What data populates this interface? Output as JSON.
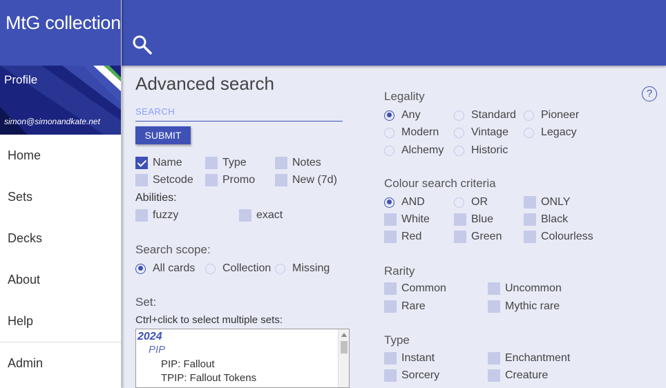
{
  "app": {
    "title": "MtG collection"
  },
  "profile": {
    "label": "Profile",
    "email": "simon@simonandkate.net"
  },
  "nav": {
    "items": [
      "Home",
      "Sets",
      "Decks",
      "About",
      "Help",
      "Admin"
    ]
  },
  "search": {
    "heading": "Advanced search",
    "placeholder": "SEARCH",
    "value": "",
    "submit_label": "SUBMIT",
    "fields": [
      {
        "label": "Name",
        "checked": true
      },
      {
        "label": "Type",
        "checked": false
      },
      {
        "label": "Notes",
        "checked": false
      },
      {
        "label": "Setcode",
        "checked": false
      },
      {
        "label": "Promo",
        "checked": false
      },
      {
        "label": "New (7d)",
        "checked": false
      }
    ],
    "abilities_label": "Abilities:",
    "abilities": [
      {
        "label": "fuzzy",
        "checked": false
      },
      {
        "label": "exact",
        "checked": false
      }
    ],
    "scope_label": "Search scope:",
    "scope": [
      {
        "label": "All cards",
        "selected": true
      },
      {
        "label": "Collection",
        "selected": false
      },
      {
        "label": "Missing",
        "selected": false
      }
    ],
    "set_label": "Set:",
    "set_hint": "Ctrl+click to select multiple sets:",
    "set_list": {
      "group_year": "2024",
      "group_code": "PIP",
      "items": [
        "PIP: Fallout",
        "TPIP: Fallout Tokens"
      ]
    }
  },
  "legality": {
    "label": "Legality",
    "options": [
      {
        "label": "Any",
        "selected": true
      },
      {
        "label": "Standard",
        "selected": false
      },
      {
        "label": "Pioneer",
        "selected": false
      },
      {
        "label": "Modern",
        "selected": false
      },
      {
        "label": "Vintage",
        "selected": false
      },
      {
        "label": "Legacy",
        "selected": false
      },
      {
        "label": "Alchemy",
        "selected": false
      },
      {
        "label": "Historic",
        "selected": false
      }
    ]
  },
  "colour": {
    "label": "Colour search criteria",
    "modes": [
      {
        "label": "AND",
        "selected": true
      },
      {
        "label": "OR",
        "selected": false
      }
    ],
    "only": {
      "label": "ONLY",
      "checked": false
    },
    "colours": [
      {
        "label": "White",
        "checked": false
      },
      {
        "label": "Blue",
        "checked": false
      },
      {
        "label": "Black",
        "checked": false
      },
      {
        "label": "Red",
        "checked": false
      },
      {
        "label": "Green",
        "checked": false
      },
      {
        "label": "Colourless",
        "checked": false
      }
    ]
  },
  "rarity": {
    "label": "Rarity",
    "options": [
      {
        "label": "Common",
        "checked": false
      },
      {
        "label": "Uncommon",
        "checked": false
      },
      {
        "label": "Rare",
        "checked": false
      },
      {
        "label": "Mythic rare",
        "checked": false
      }
    ]
  },
  "type": {
    "label": "Type",
    "options": [
      {
        "label": "Instant",
        "checked": false
      },
      {
        "label": "Enchantment",
        "checked": false
      },
      {
        "label": "Sorcery",
        "checked": false
      },
      {
        "label": "Creature",
        "checked": false
      }
    ]
  },
  "help": {
    "glyph": "?"
  },
  "theme": {
    "primary": "#3f51b5",
    "background": "#e8eaf6",
    "checkbox_off": "#c5cae9"
  }
}
